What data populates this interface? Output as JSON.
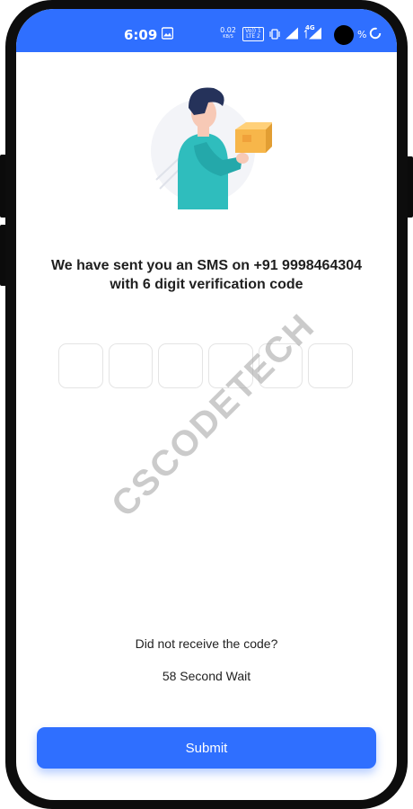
{
  "status_bar": {
    "time": "6:09",
    "net_speed_value": "0.02",
    "net_speed_unit": "KB/S",
    "volte_top": "Vo)) 1",
    "volte_bottom": "LTE 2",
    "network": "4G",
    "battery_pct": "%",
    "color": "#2f6fff"
  },
  "verification": {
    "heading_line1": "We have sent you an SMS on +91 9998464304",
    "heading_line2": "with 6 digit verification code",
    "otp_boxes": 6,
    "resend_question": "Did not receive the code?",
    "wait_text": "58 Second Wait",
    "submit_label": "Submit"
  },
  "watermark": "CSCODETECH",
  "colors": {
    "accent": "#2f6fff",
    "text": "#1f1f1f"
  }
}
